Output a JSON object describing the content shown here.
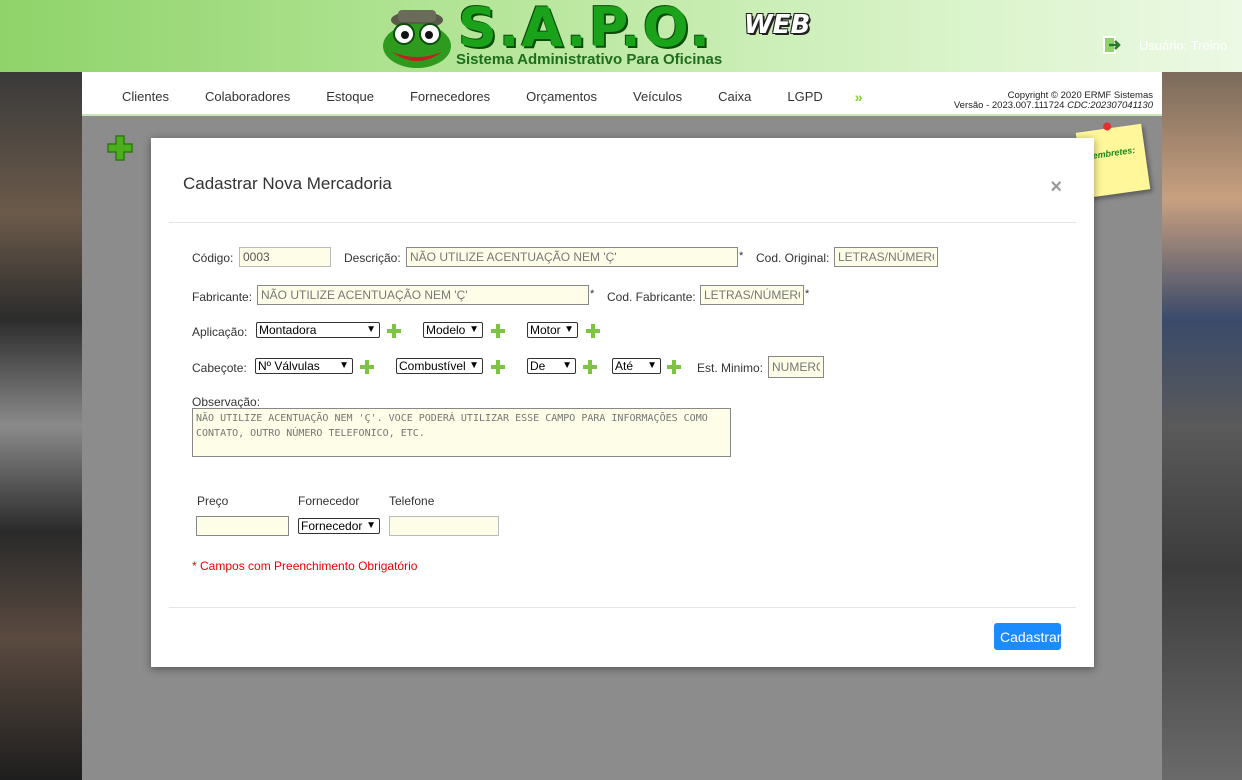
{
  "header": {
    "logo_title": "S.A.P.O.",
    "logo_web": "WEB",
    "logo_subtitle": "Sistema Administrativo Para Oficinas",
    "user_label": "Usuário: Treino"
  },
  "nav": {
    "items": [
      "Clientes",
      "Colaboradores",
      "Estoque",
      "Fornecedores",
      "Orçamentos",
      "Veículos",
      "Caixa",
      "LGPD"
    ],
    "more": "»"
  },
  "copyright": {
    "line1": "Copyright © 2020 ERMF Sistemas",
    "version": "Versão - 2023.007.111724",
    "cdc": "CDC:202307041130"
  },
  "sticky": {
    "label": "Lembretes:"
  },
  "modal": {
    "title": "Cadastrar Nova Mercadoria",
    "close": "×",
    "codigo_label": "Código:",
    "codigo_value": "0003",
    "descricao_label": "Descrição:",
    "descricao_placeholder": "NÃO UTILIZE ACENTUAÇÃO NEM 'Ç'",
    "cod_original_label": "Cod. Original:",
    "cod_original_placeholder": "LETRAS/NÚMEROS",
    "fabricante_label": "Fabricante:",
    "fabricante_placeholder": "NÃO UTILIZE ACENTUAÇÃO NEM 'Ç'",
    "cod_fabricante_label": "Cod. Fabricante:",
    "cod_fabricante_placeholder": "LETRAS/NÚMEROS",
    "aplicacao_label": "Aplicação:",
    "montadora": "Montadora",
    "modelo": "Modelo",
    "motor": "Motor",
    "cabecote_label": "Cabeçote:",
    "valvulas": "Nº Válvulas",
    "combustivel": "Combustível",
    "de": "De",
    "ate": "Até",
    "est_minimo_label": "Est. Minimo:",
    "est_minimo_placeholder": "NUMERO",
    "observacao_label": "Observação:",
    "observacao_placeholder": "NÃO UTILIZE ACENTUAÇÃO NEM 'Ç'. VOCE PODERÁ UTILIZAR ESSE CAMPO PARA INFORMAÇÕES COMO CONTATO, OUTRO NÚMERO TELEFONICO, ETC.",
    "preco_label": "Preço",
    "fornecedor_label": "Fornecedor",
    "fornecedor_select": "Fornecedor",
    "telefone_label": "Telefone",
    "required_note": "* Campos com Preenchimento Obrigatório",
    "star": "*",
    "submit": "Cadastrar"
  },
  "colors": {
    "accent": "#1a8cff",
    "brand_green": "#1aa31a",
    "required": "#e00000",
    "field_bg": "#fefee8"
  }
}
